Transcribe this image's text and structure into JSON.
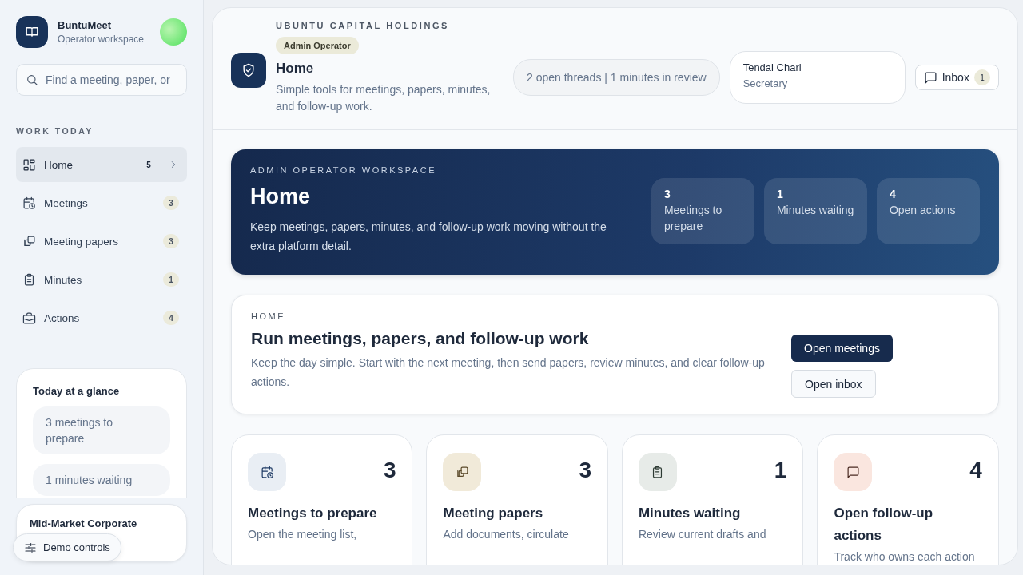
{
  "sidebar": {
    "brand": {
      "name": "BuntuMeet",
      "subtitle": "Operator workspace"
    },
    "search": {
      "placeholder": "Find a meeting, paper, or"
    },
    "section_label": "WORK TODAY",
    "items": [
      {
        "label": "Home",
        "count": "5",
        "selected": true
      },
      {
        "label": "Meetings",
        "count": "3",
        "selected": false
      },
      {
        "label": "Meeting papers",
        "count": "3",
        "selected": false
      },
      {
        "label": "Minutes",
        "count": "1",
        "selected": false
      },
      {
        "label": "Actions",
        "count": "4",
        "selected": false
      }
    ],
    "glance": {
      "title": "Today at a glance",
      "items": [
        "3 meetings to prepare",
        "1 minutes waiting"
      ]
    },
    "plan_card": {
      "title": "Mid-Market Corporate"
    },
    "demo_button": "Demo controls"
  },
  "header": {
    "org": "UBUNTU CAPITAL HOLDINGS",
    "role_badge": "Admin Operator",
    "title": "Home",
    "description": "Simple tools for meetings, papers, minutes, and follow-up work.",
    "status": "2 open threads | 1 minutes in review",
    "user": {
      "name": "Tendai Chari",
      "role": "Secretary"
    },
    "inbox": {
      "label": "Inbox",
      "count": "1"
    }
  },
  "hero": {
    "eyebrow": "ADMIN OPERATOR WORKSPACE",
    "title": "Home",
    "text": "Keep meetings, papers, minutes, and follow-up work moving without the extra platform detail.",
    "stats": [
      {
        "value": "3",
        "label": "Meetings to prepare"
      },
      {
        "value": "1",
        "label": "Minutes waiting"
      },
      {
        "value": "4",
        "label": "Open actions"
      }
    ]
  },
  "home_card": {
    "eyebrow": "HOME",
    "title": "Run meetings, papers, and follow-up work",
    "text": "Keep the day simple. Start with the next meeting, then send papers, review minutes, and clear follow-up actions.",
    "buttons": [
      {
        "label": "Open meetings",
        "kind": "primary"
      },
      {
        "label": "Open inbox",
        "kind": "secondary"
      }
    ]
  },
  "cards": [
    {
      "value": "3",
      "title": "Meetings to prepare",
      "text": "Open the meeting list,"
    },
    {
      "value": "3",
      "title": "Meeting papers",
      "text": "Add documents, circulate"
    },
    {
      "value": "1",
      "title": "Minutes waiting",
      "text": "Review current drafts and"
    },
    {
      "value": "4",
      "title": "Open follow-up actions",
      "text": "Track who owns each action"
    }
  ]
}
